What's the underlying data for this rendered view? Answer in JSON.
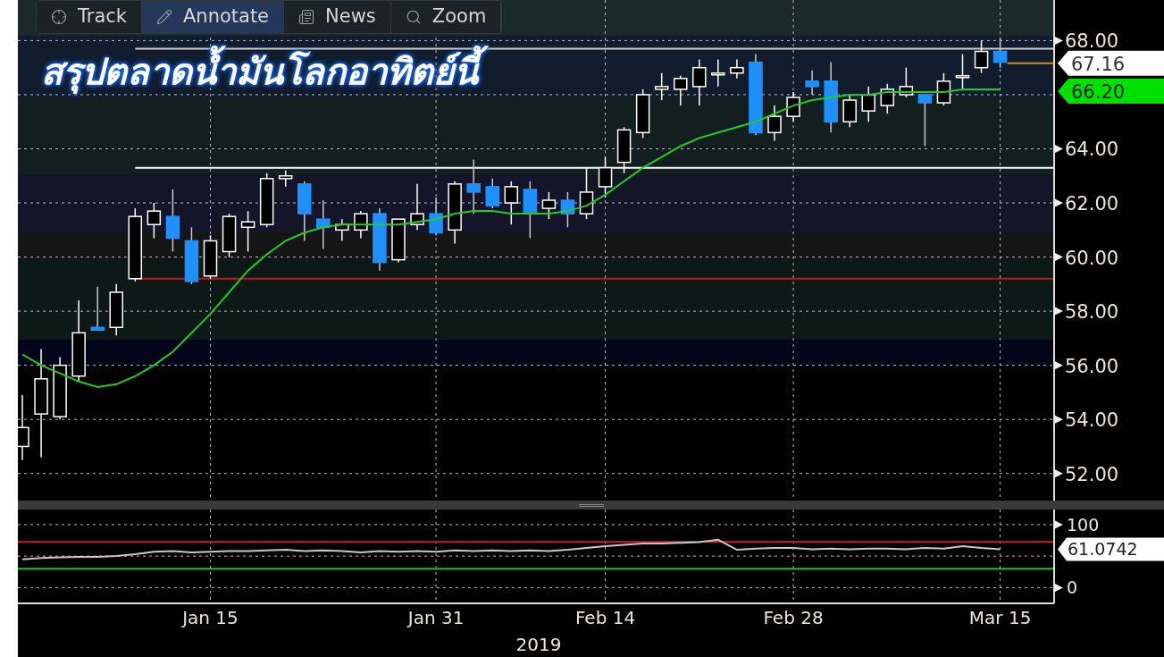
{
  "toolbar": [
    {
      "kind": "track",
      "label": "Track",
      "selected": false
    },
    {
      "kind": "annotate",
      "label": "Annotate",
      "selected": true
    },
    {
      "kind": "news",
      "label": "News",
      "selected": false
    },
    {
      "kind": "zoom",
      "label": "Zoom",
      "selected": false
    }
  ],
  "headline": "สรุปตลาดน้ำมันโลกอาทิตย์นี้",
  "price_chart": {
    "last_price": "67.16",
    "average_price": "66.20",
    "chart_data": {
      "type": "candlestick",
      "grid": true,
      "ohlc": [
        [
          53.0,
          54.9,
          52.5,
          53.7
        ],
        [
          54.2,
          56.6,
          52.6,
          55.5
        ],
        [
          54.1,
          56.3,
          54.0,
          56.0
        ],
        [
          55.6,
          58.4,
          55.4,
          57.2
        ],
        [
          57.4,
          58.9,
          57.3,
          57.3
        ],
        [
          57.4,
          59.0,
          57.1,
          58.7
        ],
        [
          59.2,
          61.8,
          59.1,
          61.5
        ],
        [
          61.2,
          62.0,
          60.7,
          61.7
        ],
        [
          61.5,
          62.5,
          60.2,
          60.7
        ],
        [
          60.6,
          61.1,
          59.0,
          59.1
        ],
        [
          59.3,
          60.8,
          59.2,
          60.6
        ],
        [
          60.2,
          61.6,
          60.0,
          61.5
        ],
        [
          61.1,
          61.7,
          60.2,
          61.3
        ],
        [
          61.2,
          63.1,
          61.1,
          62.9
        ],
        [
          62.9,
          63.2,
          62.6,
          63.0
        ],
        [
          62.7,
          62.8,
          60.6,
          61.6
        ],
        [
          61.4,
          62.1,
          60.3,
          61.1
        ],
        [
          61.0,
          61.4,
          60.6,
          61.2
        ],
        [
          61.0,
          61.7,
          60.7,
          61.6
        ],
        [
          61.6,
          61.8,
          59.5,
          59.8
        ],
        [
          59.9,
          61.4,
          59.8,
          61.4
        ],
        [
          61.2,
          62.7,
          61.0,
          61.6
        ],
        [
          61.6,
          62.2,
          60.8,
          60.9
        ],
        [
          61.0,
          62.8,
          60.5,
          62.7
        ],
        [
          62.7,
          63.6,
          61.6,
          62.4
        ],
        [
          62.6,
          62.9,
          61.8,
          61.9
        ],
        [
          62.0,
          62.8,
          61.2,
          62.6
        ],
        [
          62.5,
          62.8,
          60.7,
          61.6
        ],
        [
          61.8,
          62.4,
          61.4,
          62.1
        ],
        [
          62.1,
          62.4,
          61.1,
          61.6
        ],
        [
          61.6,
          63.3,
          61.4,
          62.4
        ],
        [
          62.6,
          63.7,
          62.2,
          63.3
        ],
        [
          63.5,
          64.8,
          63.1,
          64.7
        ],
        [
          64.6,
          66.2,
          64.4,
          66.0
        ],
        [
          66.2,
          66.8,
          65.8,
          66.3
        ],
        [
          66.2,
          66.7,
          65.6,
          66.6
        ],
        [
          66.3,
          67.3,
          65.6,
          67.0
        ],
        [
          66.8,
          67.3,
          66.3,
          66.8
        ],
        [
          66.8,
          67.3,
          66.6,
          67.0
        ],
        [
          67.2,
          67.5,
          64.5,
          64.6
        ],
        [
          64.6,
          65.6,
          64.3,
          65.2
        ],
        [
          65.2,
          66.1,
          65.0,
          65.9
        ],
        [
          66.5,
          66.9,
          66.0,
          66.3
        ],
        [
          66.5,
          67.2,
          64.6,
          65.0
        ],
        [
          65.0,
          66.0,
          64.8,
          65.8
        ],
        [
          65.4,
          66.3,
          65.0,
          66.0
        ],
        [
          65.6,
          66.4,
          65.3,
          66.2
        ],
        [
          66.0,
          67.0,
          65.9,
          66.3
        ],
        [
          66.0,
          66.0,
          64.1,
          65.7
        ],
        [
          65.7,
          66.8,
          65.6,
          66.5
        ],
        [
          66.7,
          67.5,
          66.2,
          66.7
        ],
        [
          67.0,
          68.0,
          66.8,
          67.6
        ],
        [
          67.6,
          68.1,
          67.0,
          67.2
        ]
      ],
      "series": [
        {
          "type": "line",
          "color": "#22cc22",
          "values": [
            56.4,
            56.0,
            55.7,
            55.4,
            55.2,
            55.3,
            55.6,
            56.0,
            56.5,
            57.2,
            57.9,
            58.7,
            59.5,
            60.1,
            60.6,
            60.9,
            61.1,
            61.2,
            61.2,
            61.2,
            61.2,
            61.3,
            61.4,
            61.6,
            61.7,
            61.7,
            61.6,
            61.6,
            61.6,
            61.7,
            61.9,
            62.3,
            62.8,
            63.3,
            63.7,
            64.1,
            64.4,
            64.6,
            64.8,
            65.0,
            65.3,
            65.6,
            65.8,
            65.9,
            66.0,
            66.0,
            66.1,
            66.1,
            66.1,
            66.1,
            66.2,
            66.2,
            66.2
          ]
        }
      ],
      "ylim": [
        51,
        69.5
      ],
      "yticks": [
        {
          "value": 52,
          "label": "52.00"
        },
        {
          "value": 54,
          "label": "54.00"
        },
        {
          "value": 56,
          "label": "56.00"
        },
        {
          "value": 58,
          "label": "58.00"
        },
        {
          "value": 60,
          "label": "60.00"
        },
        {
          "value": 62,
          "label": "62.00"
        },
        {
          "value": 64,
          "label": "64.00"
        },
        {
          "value": 68,
          "label": "68.00"
        }
      ],
      "ref_lines": [
        {
          "axis": "y",
          "value": 59.2,
          "color": "#c0161b"
        },
        {
          "axis": "y",
          "value": 63.3,
          "color": "#ffffff"
        },
        {
          "axis": "y",
          "value": 67.7,
          "color": "#d0d0d0"
        }
      ]
    }
  },
  "indicator_chart": {
    "last_value": "61.0742",
    "year": "2019",
    "chart_data": {
      "type": "line",
      "grid": true,
      "categories": [
        null,
        null,
        null,
        null,
        null,
        null,
        null,
        null,
        null,
        null,
        "Jan 15",
        null,
        null,
        null,
        null,
        null,
        null,
        null,
        null,
        null,
        null,
        null,
        "Jan 31",
        null,
        null,
        null,
        null,
        null,
        null,
        null,
        null,
        "Feb 14",
        null,
        null,
        null,
        null,
        null,
        null,
        null,
        null,
        null,
        "Feb 28",
        null,
        null,
        null,
        null,
        null,
        null,
        null,
        null,
        null,
        null,
        "Mar 15"
      ],
      "series": [
        {
          "color": "#c8c8c8",
          "values": [
            45,
            47,
            48,
            49,
            49,
            50,
            53,
            57,
            58,
            56,
            57,
            58,
            58,
            59,
            60,
            58,
            59,
            58,
            56,
            58,
            57,
            58,
            57,
            59,
            58,
            59,
            58,
            59,
            58,
            60,
            63,
            66,
            68,
            70,
            70,
            71,
            72,
            76,
            60,
            62,
            63,
            63,
            61,
            62,
            61,
            62,
            62,
            61,
            63,
            62,
            66,
            63,
            61
          ]
        }
      ],
      "ylim": [
        -25,
        124
      ],
      "yticks": [
        0,
        100
      ],
      "ref_lines": [
        {
          "axis": "y",
          "value": 73,
          "color": "#c0161b"
        },
        {
          "axis": "y",
          "value": 30,
          "color": "#1fbf1f"
        }
      ]
    }
  }
}
